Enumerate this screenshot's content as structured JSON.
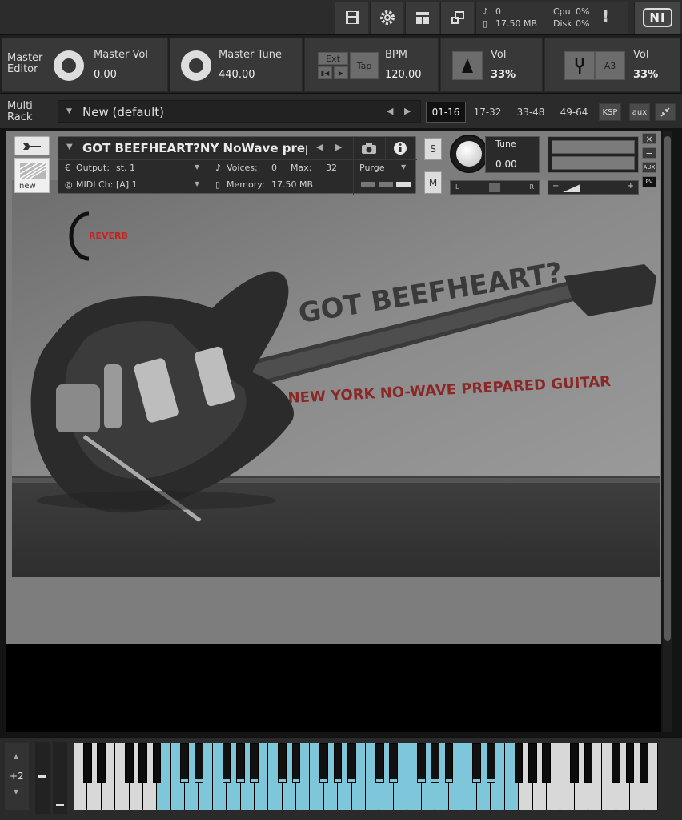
{
  "toolbar": {
    "icons": [
      "save-icon",
      "gear-icon",
      "layout-icon",
      "resize-icon"
    ],
    "voices_value": "0",
    "memory_value": "17.50 MB",
    "cpu_label": "Cpu",
    "cpu_value": "0%",
    "disk_label": "Disk",
    "disk_value": "0%",
    "warning_symbol": "!",
    "logo_text": "NI"
  },
  "master": {
    "editor_label_1": "Master",
    "editor_label_2": "Editor",
    "vol_label": "Master Vol",
    "vol_value": "0.00",
    "tune_label": "Master Tune",
    "tune_value": "440.00",
    "ext_label": "Ext",
    "tap_label": "Tap",
    "bpm_label": "BPM",
    "bpm_value": "120.00",
    "metronome_vol_label": "Vol",
    "metronome_vol_value": "33%",
    "tuner_note": "A3",
    "tuner_vol_label": "Vol",
    "tuner_vol_value": "33%"
  },
  "rack": {
    "label_1": "Multi",
    "label_2": "Rack",
    "name": "New (default)",
    "pages": [
      "01-16",
      "17-32",
      "33-48",
      "49-64"
    ],
    "active_page": "01-16",
    "ksp_label": "KSP",
    "aux_label": "aux"
  },
  "instrument": {
    "title": "GOT BEEFHEART?NY NoWave prepa",
    "output_label": "Output:",
    "output_value": "st. 1",
    "voices_label": "Voices:",
    "voices_value": "0",
    "max_label": "Max:",
    "max_value": "32",
    "purge_label": "Purge",
    "midi_label": "MIDI Ch:",
    "midi_value": "[A]  1",
    "memory_label": "Memory:",
    "memory_value": "17.50 MB",
    "solo_label": "S",
    "mute_label": "M",
    "tune_label": "Tune",
    "tune_value": "0.00",
    "pan_left": "L",
    "pan_right": "R",
    "vol_minus": "−",
    "vol_plus": "+",
    "side_close": "×",
    "side_min": "−",
    "side_aux": "AUX",
    "side_pv": "PV",
    "new_tile_label": "new"
  },
  "artwork": {
    "reverb_label": "REVERB",
    "headline": "GOT BEEFHEART?",
    "subline": "NEW YORK NO-WAVE PREPARED GUITAR"
  },
  "keyboard": {
    "octave_value": "+2",
    "highlight_color": "#7ec6da"
  }
}
